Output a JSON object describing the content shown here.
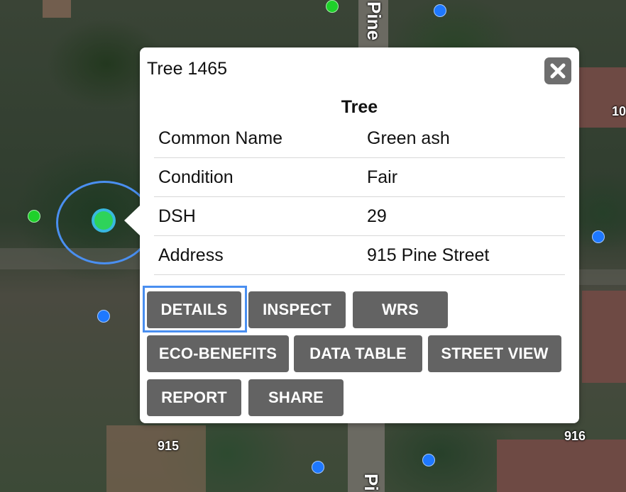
{
  "map": {
    "road_labels": [
      "Pine",
      "Pi"
    ],
    "address_labels": [
      "10",
      "915",
      "916"
    ],
    "tree_point_colors": {
      "blue": "#1e78ff",
      "green": "#1ed12a"
    },
    "selection_color": "#4a8ff0"
  },
  "popup": {
    "title": "Tree 1465",
    "close_icon": "close-icon",
    "layer_title": "Tree",
    "attributes": [
      {
        "label": "Common Name",
        "value": "Green ash"
      },
      {
        "label": "Condition",
        "value": "Fair"
      },
      {
        "label": "DSH",
        "value": "29"
      },
      {
        "label": "Address",
        "value": "915 Pine Street"
      }
    ],
    "buttons": {
      "details": "DETAILS",
      "inspect": "INSPECT",
      "wrs": "WRS",
      "eco_benefits": "ECO-BENEFITS",
      "data_table": "DATA TABLE",
      "street_view": "STREET VIEW",
      "report": "REPORT",
      "share": "SHARE"
    },
    "focused_button": "DETAILS"
  }
}
